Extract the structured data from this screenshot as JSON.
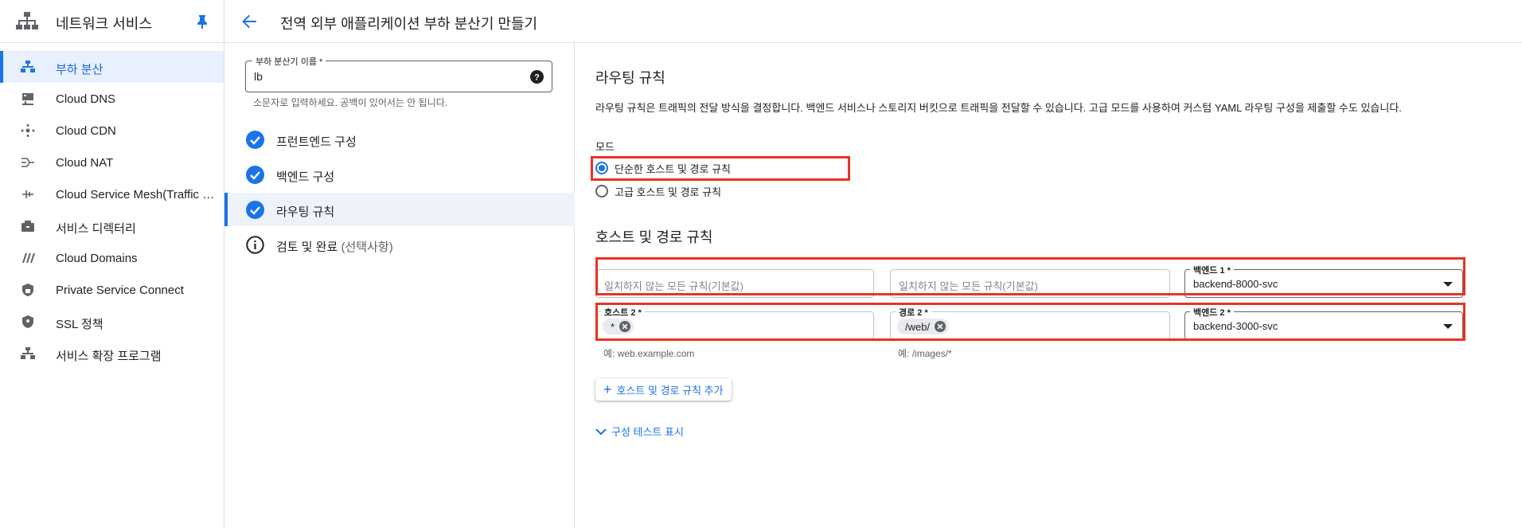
{
  "sidebar": {
    "title": "네트워크 서비스",
    "items": [
      {
        "label": "부하 분산"
      },
      {
        "label": "Cloud DNS"
      },
      {
        "label": "Cloud CDN"
      },
      {
        "label": "Cloud NAT"
      },
      {
        "label": "Cloud Service Mesh(Traffic Director)"
      },
      {
        "label": "서비스 디렉터리"
      },
      {
        "label": "Cloud Domains"
      },
      {
        "label": "Private Service Connect"
      },
      {
        "label": "SSL 정책"
      },
      {
        "label": "서비스 확장 프로그램"
      }
    ]
  },
  "header": {
    "title": "전역 외부 애플리케이션 부하 분산기 만들기"
  },
  "form": {
    "name_label": "부하 분산기 이름 *",
    "name_value": "lb",
    "name_hint": "소문자로 입력하세요. 공백이 있어서는 안 됩니다."
  },
  "steps": [
    {
      "label": "프런트엔드 구성"
    },
    {
      "label": "백엔드 구성"
    },
    {
      "label": "라우팅 규칙"
    },
    {
      "label": "검토 및 완료",
      "optional": "(선택사항)"
    }
  ],
  "main": {
    "routing_title": "라우팅 규칙",
    "routing_desc": "라우팅 규칙은 트래픽의 전달 방식을 결정합니다. 백엔드 서비스나 스토리지 버킷으로 트래픽을 전달할 수 있습니다. 고급 모드를 사용하여 커스텀 YAML 라우팅 구성을 제출할 수도 있습니다.",
    "mode_label": "모드",
    "mode_simple": "단순한 호스트 및 경로 규칙",
    "mode_advanced": "고급 호스트 및 경로 규칙",
    "host_path_title": "호스트 및 경로 규칙",
    "rule1": {
      "host_placeholder": "일치하지 않는 모든 규칙(기본값)",
      "path_placeholder": "일치하지 않는 모든 규칙(기본값)",
      "backend_label": "백엔드 1 *",
      "backend_value": "backend-8000-svc"
    },
    "rule2": {
      "host_label": "호스트 2 *",
      "host_chip": "*",
      "path_label": "경로 2 *",
      "path_chip": "/web/",
      "backend_label": "백엔드 2 *",
      "backend_value": "backend-3000-svc",
      "host_hint": "예: web.example.com",
      "path_hint": "예: /images/*"
    },
    "add_rule": "호스트 및 경로 규칙 추가",
    "show_test": "구성 테스트 표시"
  }
}
